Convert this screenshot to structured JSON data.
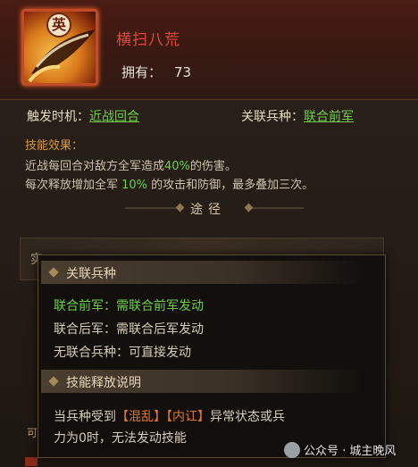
{
  "skill": {
    "badge": "英",
    "name": "横扫八荒",
    "owned_label": "拥有：",
    "owned_count": "73"
  },
  "trigger": {
    "label": "触发时机：",
    "value": "近战回合"
  },
  "troop": {
    "label": "关联兵种：",
    "value": "联合前军"
  },
  "effect": {
    "title": "技能效果：",
    "line1_pre": "近战每回合对敌方全军造成",
    "line1_hl": "40%",
    "line1_post": "的伤害。",
    "line2_pre": "每次释放增加全军 ",
    "line2_hl": "10%",
    "line2_post": " 的攻击和防御，最多叠加三次。"
  },
  "path": {
    "title": "途径",
    "box_char": "实"
  },
  "tooltip": {
    "section1_title": "关联兵种",
    "line1": "联合前军：需联合前军发动",
    "line2": "联合后军：需联合后军发动",
    "line3": "无联合兵种：可直接发动",
    "section2_title": "技能释放说明",
    "desc_pre": "当兵种受到",
    "desc_tag1": "【混乱】",
    "desc_tag2": "【内讧】",
    "desc_post": "异常状态或兵",
    "desc_line2": "力为0时，无法发动技能"
  },
  "watermark": {
    "text": "公众号 · 城主晚风"
  },
  "bottom": {
    "char": "可"
  },
  "colors": {
    "accent_red": "#e0493a",
    "accent_green": "#6fcf4a",
    "accent_orange": "#e07a2a",
    "section_gold": "#d99a3c"
  },
  "icons": {
    "skill_icon": "sword-slash-icon",
    "wechat_icon": "wechat-icon"
  }
}
